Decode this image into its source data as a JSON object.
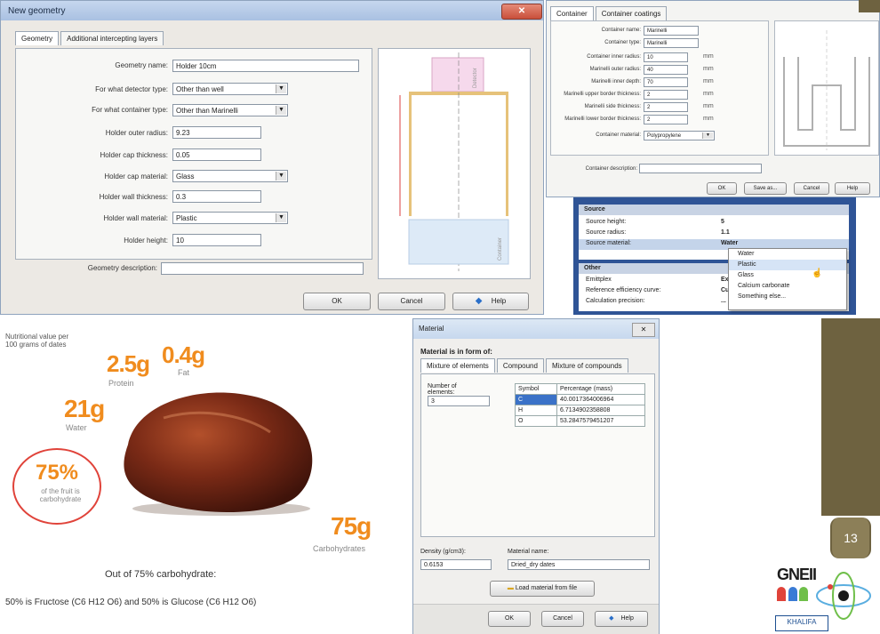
{
  "new_geometry": {
    "title": "New geometry",
    "close": "✕",
    "tabs": [
      "Geometry",
      "Additional intercepting layers"
    ],
    "fields": [
      {
        "label": "Geometry name:",
        "value": "Holder 10cm"
      },
      {
        "label": "For what detector type:",
        "value": "Other than well"
      },
      {
        "label": "For what container type:",
        "value": "Other than Marinelli"
      },
      {
        "label": "Holder outer radius:",
        "value": "9.23"
      },
      {
        "label": "Holder cap thickness:",
        "value": "0.05"
      },
      {
        "label": "Holder cap material:",
        "value": "Glass"
      },
      {
        "label": "Holder wall thickness:",
        "value": "0.3"
      },
      {
        "label": "Holder wall material:",
        "value": "Plastic"
      },
      {
        "label": "Holder height:",
        "value": "10"
      }
    ],
    "description_label": "Geometry description:",
    "description_value": "",
    "preview_labels": {
      "top": "Detector",
      "bottom": "Container"
    },
    "ok": "OK",
    "cancel": "Cancel",
    "help": "Help"
  },
  "container_panel": {
    "tabs": [
      "Container",
      "Container coatings"
    ],
    "fields": [
      {
        "label": "Container name:",
        "value": "Marinelli"
      },
      {
        "label": "Container type:",
        "value": "Marinelli"
      },
      {
        "label": "Container inner radius:",
        "value": "10",
        "unit": "mm"
      },
      {
        "label": "Marinelli outer radius:",
        "value": "40",
        "unit": "mm"
      },
      {
        "label": "Marinelli inner depth:",
        "value": "70",
        "unit": "mm"
      },
      {
        "label": "Marinelli upper border thickness:",
        "value": "2",
        "unit": "mm"
      },
      {
        "label": "Marinelli side thickness:",
        "value": "2",
        "unit": "mm"
      },
      {
        "label": "Marinelli lower border thickness:",
        "value": "2",
        "unit": "mm"
      }
    ],
    "material_label": "Container material:",
    "material_value": "Polypropylene",
    "description_label": "Container description:",
    "description_value": "",
    "buttons": [
      "OK",
      "Save as...",
      "Cancel",
      "Help"
    ]
  },
  "source_panel": {
    "header_source": "Source",
    "rows": [
      {
        "label": "Source height:",
        "value": "5"
      },
      {
        "label": "Source radius:",
        "value": "1.1"
      },
      {
        "label": "Source material:",
        "value": "Water"
      }
    ],
    "header_other": "Other",
    "other_rows": [
      {
        "label": "Emittplex",
        "value": "Ex"
      },
      {
        "label": "Reference efficiency curve:",
        "value": "Cu"
      },
      {
        "label": "Calculation precision:",
        "value": "..."
      }
    ],
    "dropdown": [
      "Water",
      "Plastic",
      "Glass",
      "Calcium carbonate",
      "Something else..."
    ],
    "dropdown_highlighted": 1
  },
  "infographic": {
    "intro": "Nutritional value per 100 grams of dates",
    "protein_value": "2.5g",
    "protein_label": "Protein",
    "fat_value": "0.4g",
    "fat_label": "Fat",
    "water_value": "21g",
    "water_label": "Water",
    "carb_pct": "75%",
    "carb_pct_label": "of the fruit is carbohydrate",
    "carb_value": "75g",
    "carb_label": "Carbohydrates",
    "line1": "Out of 75% carbohydrate:",
    "line2": "50% is Fructose (C6 H12 O6) and 50% is Glucose (C6 H12 O6)",
    "colors": {
      "accent": "#f08c1e",
      "circle": "#e0433a",
      "date": "#7a2a16"
    }
  },
  "material_dialog": {
    "title": "Material",
    "close": "✕",
    "section": "Material is in form of:",
    "tabs": [
      "Mixture of elements",
      "Compound",
      "Mixture of compounds"
    ],
    "num_elements_label": "Number of elements:",
    "num_elements_value": "3",
    "table_headers": [
      "Symbol",
      "Percentage (mass)"
    ],
    "table_rows": [
      {
        "symbol": "C",
        "pct": "40.0017364006964"
      },
      {
        "symbol": "H",
        "pct": "6.7134902358808"
      },
      {
        "symbol": "O",
        "pct": "53.2847579451207"
      }
    ],
    "density_label": "Density (g/cm3):",
    "density_value": "0.6153",
    "name_label": "Material name:",
    "name_value": "Dried_dry dates",
    "load_button": "Load material from file",
    "ok": "OK",
    "cancel": "Cancel",
    "help": "Help"
  },
  "slide": {
    "page_number": "13",
    "logo_text": "GNEII",
    "university": "KHALIFA",
    "colors": {
      "side_panel": "#6e6240"
    }
  }
}
